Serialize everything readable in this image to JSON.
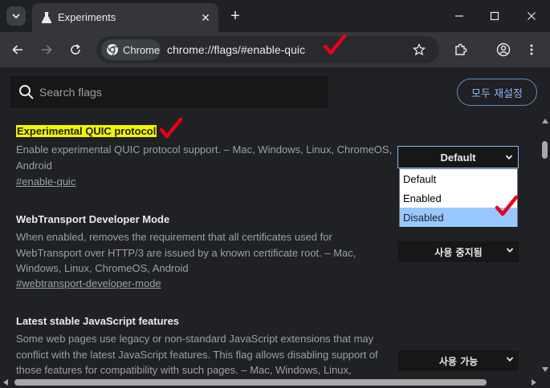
{
  "tab": {
    "title": "Experiments",
    "close": "✕",
    "new_tab": "+"
  },
  "toolbar": {
    "chip_label": "Chrome",
    "url": "chrome://flags/#enable-quic"
  },
  "search": {
    "placeholder": "Search flags"
  },
  "reset_button": "모두 재설정",
  "flags": [
    {
      "title": "Experimental QUIC protocol",
      "description": "Enable experimental QUIC protocol support. – Mac, Windows, Linux, ChromeOS, Android",
      "link": "#enable-quic",
      "select_value": "Default",
      "options": [
        "Default",
        "Enabled",
        "Disabled"
      ],
      "highlighted_option": "Disabled"
    },
    {
      "title": "WebTransport Developer Mode",
      "description": "When enabled, removes the requirement that all certificates used for WebTransport over HTTP/3 are issued by a known certificate root. – Mac, Windows, Linux, ChromeOS, Android",
      "link": "#webtransport-developer-mode",
      "select_value": "사용 중지됨"
    },
    {
      "title": "Latest stable JavaScript features",
      "description": "Some web pages use legacy or non-standard JavaScript extensions that may conflict with the latest JavaScript features. This flag allows disabling support of those features for compatibility with such pages. – Mac, Windows, Linux,",
      "select_value": "사용 가능"
    }
  ],
  "colors": {
    "background": "#202124",
    "toolbar": "#35363a",
    "highlight": "#f5f500",
    "accent_blue": "#8ab4f8",
    "check_red": "#e8001c",
    "option_selected": "#99c8ff"
  }
}
